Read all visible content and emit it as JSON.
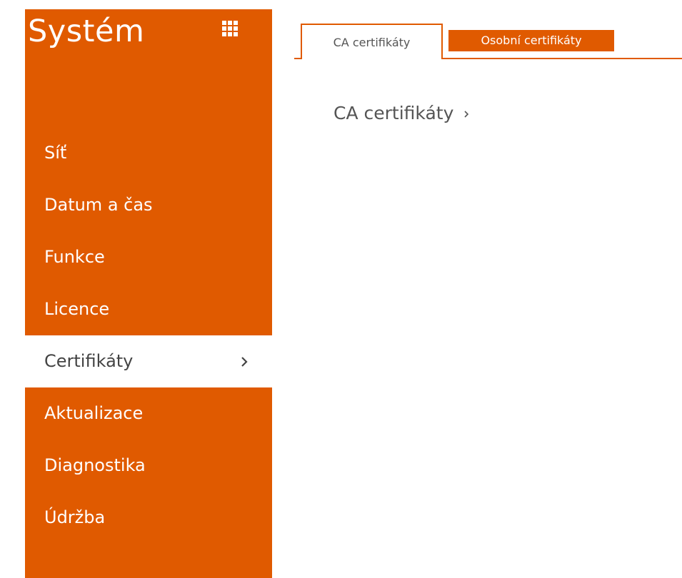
{
  "sidebar": {
    "title": "Systém",
    "menu_icon": "grid-menu-icon",
    "items": [
      {
        "label": "Síť",
        "active": false
      },
      {
        "label": "Datum a čas",
        "active": false
      },
      {
        "label": "Funkce",
        "active": false
      },
      {
        "label": "Licence",
        "active": false
      },
      {
        "label": "Certifikáty",
        "active": true
      },
      {
        "label": "Aktualizace",
        "active": false
      },
      {
        "label": "Diagnostika",
        "active": false
      },
      {
        "label": "Údržba",
        "active": false
      }
    ]
  },
  "tabs": [
    {
      "label": "CA certifikáty",
      "active": true
    },
    {
      "label": "Osobní certifikáty",
      "active": false
    }
  ],
  "main": {
    "section_heading": "CA certifikáty"
  },
  "colors": {
    "accent": "#e05a00",
    "background": "#ffffff",
    "text_dark": "#555555",
    "text_light": "#ffffff"
  }
}
